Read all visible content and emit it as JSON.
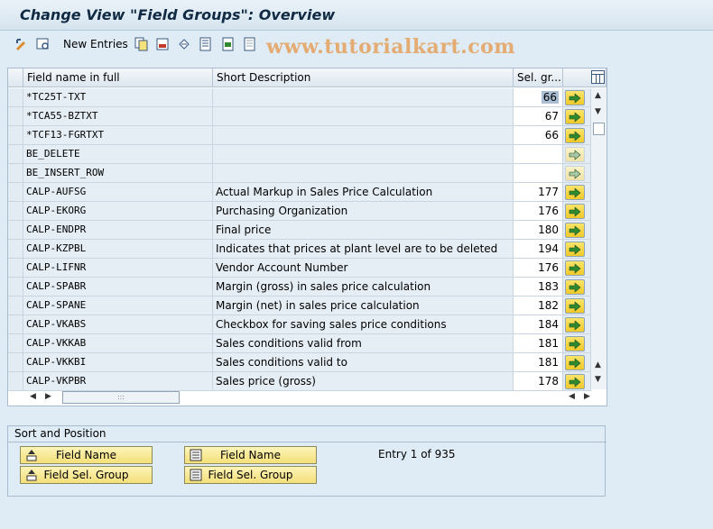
{
  "title": "Change View \"Field Groups\": Overview",
  "toolbar": {
    "new_entries": "New Entries",
    "watermark": "www.tutorialkart.com"
  },
  "table": {
    "columns": [
      "Field name in full",
      "Short Description",
      "Sel. gr..."
    ],
    "rows": [
      {
        "field": "*TC25T-TXT",
        "desc": "",
        "group": "66",
        "highlight": true,
        "action_enabled": true
      },
      {
        "field": "*TCA55-BZTXT",
        "desc": "",
        "group": "67",
        "highlight": false,
        "action_enabled": true
      },
      {
        "field": "*TCF13-FGRTXT",
        "desc": "",
        "group": "66",
        "highlight": false,
        "action_enabled": true
      },
      {
        "field": "BE_DELETE",
        "desc": "",
        "group": "",
        "highlight": false,
        "action_enabled": false
      },
      {
        "field": "BE_INSERT_ROW",
        "desc": "",
        "group": "",
        "highlight": false,
        "action_enabled": false
      },
      {
        "field": "CALP-AUFSG",
        "desc": "Actual Markup in Sales Price Calculation",
        "group": "177",
        "highlight": false,
        "action_enabled": true
      },
      {
        "field": "CALP-EKORG",
        "desc": "Purchasing Organization",
        "group": "176",
        "highlight": false,
        "action_enabled": true
      },
      {
        "field": "CALP-ENDPR",
        "desc": "Final price",
        "group": "180",
        "highlight": false,
        "action_enabled": true
      },
      {
        "field": "CALP-KZPBL",
        "desc": "Indicates that prices at plant level are to be deleted",
        "group": "194",
        "highlight": false,
        "action_enabled": true
      },
      {
        "field": "CALP-LIFNR",
        "desc": "Vendor Account Number",
        "group": "176",
        "highlight": false,
        "action_enabled": true
      },
      {
        "field": "CALP-SPABR",
        "desc": "Margin (gross) in sales price calculation",
        "group": "183",
        "highlight": false,
        "action_enabled": true
      },
      {
        "field": "CALP-SPANE",
        "desc": "Margin (net) in sales price calculation",
        "group": "182",
        "highlight": false,
        "action_enabled": true
      },
      {
        "field": "CALP-VKABS",
        "desc": "Checkbox for saving sales price conditions",
        "group": "184",
        "highlight": false,
        "action_enabled": true
      },
      {
        "field": "CALP-VKKAB",
        "desc": "Sales conditions valid from",
        "group": "181",
        "highlight": false,
        "action_enabled": true
      },
      {
        "field": "CALP-VKKBI",
        "desc": "Sales conditions valid to",
        "group": "181",
        "highlight": false,
        "action_enabled": true
      },
      {
        "field": "CALP-VKPBR",
        "desc": "Sales price (gross)",
        "group": "178",
        "highlight": false,
        "action_enabled": true
      }
    ]
  },
  "sort_position": {
    "title": "Sort and Position",
    "buttons": [
      "Field Name",
      "Field Sel. Group",
      "Field Name",
      "Field Sel. Group"
    ],
    "entry_info": "Entry 1 of 935"
  },
  "colors": {
    "background": "#dfebf5",
    "button_yellow": "#f4df7a",
    "arrow_green": "#2f8a2f"
  }
}
